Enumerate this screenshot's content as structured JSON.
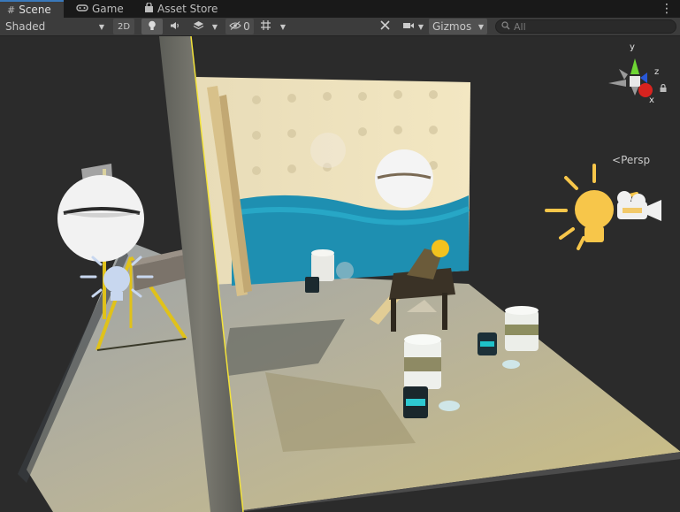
{
  "tabs": [
    {
      "label": "Scene",
      "icon": "grid-icon",
      "active": true
    },
    {
      "label": "Game",
      "icon": "gamepad-icon",
      "active": false
    },
    {
      "label": "Asset Store",
      "icon": "bag-icon",
      "active": false
    }
  ],
  "toolbar": {
    "shading_mode": "Shaded",
    "mode_2d": "2D",
    "hidden_count": "0",
    "gizmos_label": "Gizmos",
    "search_placeholder": "All"
  },
  "gizmo": {
    "axis_x": "x",
    "axis_y": "y",
    "axis_z": "z",
    "projection": "Persp"
  },
  "colors": {
    "tab_active_accent": "#3a79bb",
    "axis_x": "#d7231f",
    "axis_y": "#6ed634",
    "axis_z": "#2858d8",
    "light_gizmo": "#f7c64a"
  }
}
